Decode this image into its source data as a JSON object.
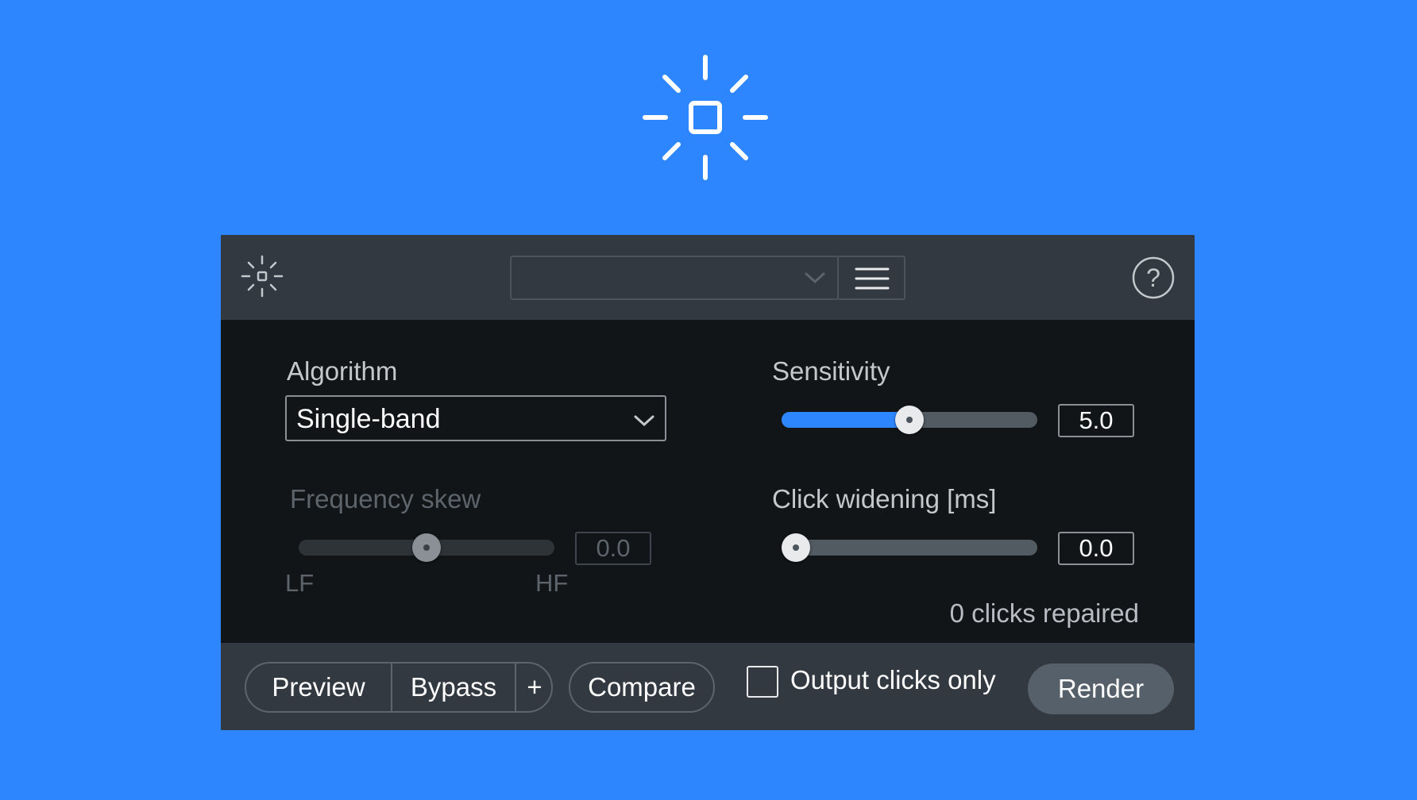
{
  "header": {
    "preset_value": "",
    "help_label": "?"
  },
  "algorithm": {
    "label": "Algorithm",
    "selected": "Single-band"
  },
  "sensitivity": {
    "label": "Sensitivity",
    "value": "5.0",
    "level_fraction": 0.5
  },
  "frequency_skew": {
    "label": "Frequency skew",
    "value": "0.0",
    "min_label": "LF",
    "max_label": "HF",
    "level_fraction": 0.5,
    "disabled": true
  },
  "click_widening": {
    "label": "Click widening [ms]",
    "value": "0.0",
    "level_fraction": 0.0
  },
  "status": {
    "text": "0 clicks repaired"
  },
  "footer": {
    "preview_label": "Preview",
    "bypass_label": "Bypass",
    "add_label": "+",
    "compare_label": "Compare",
    "output_clicks_label": "Output clicks only",
    "output_clicks_checked": false,
    "render_label": "Render"
  },
  "colors": {
    "background": "#2e86ff",
    "accent": "#2e86ff",
    "panel": "#121517",
    "header": "#323940"
  },
  "icons": {
    "hero": "de-click-sparkle-icon",
    "logo": "de-click-sparkle-icon",
    "preset_chevron": "chevron-down-icon",
    "preset_menu": "hamburger-menu-icon",
    "help": "help-circle-icon"
  }
}
